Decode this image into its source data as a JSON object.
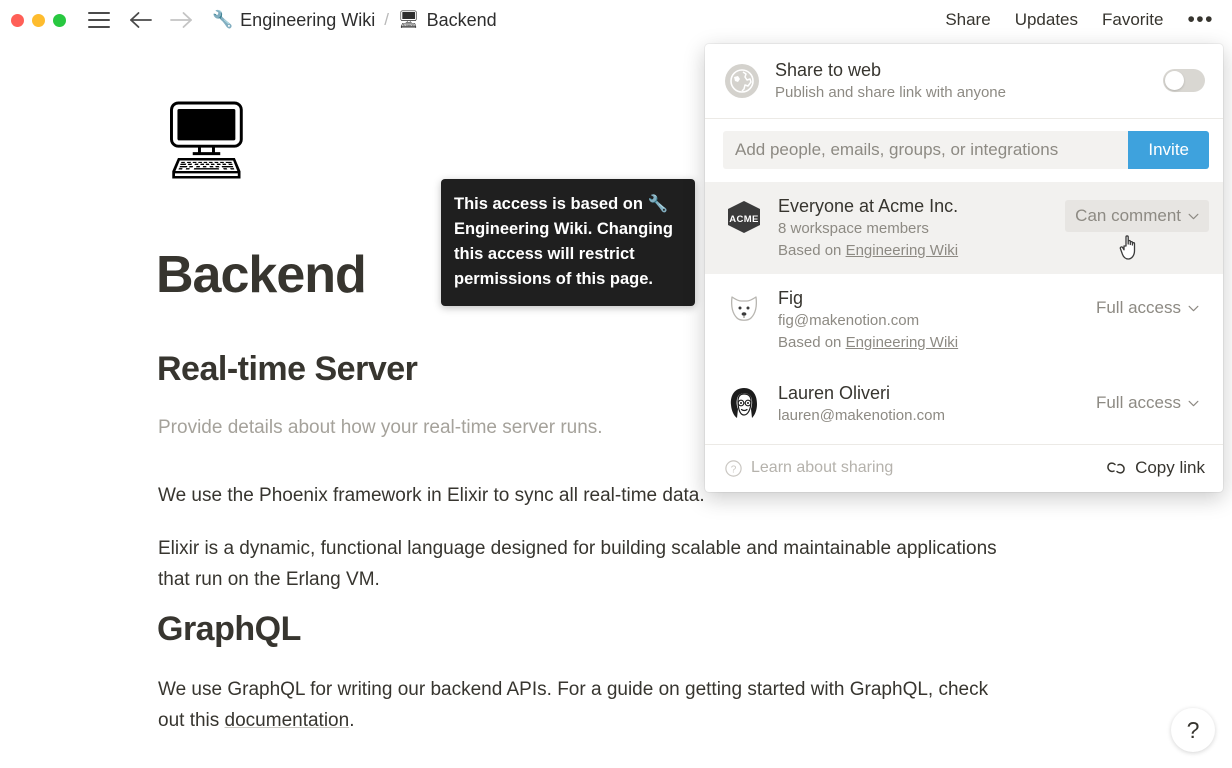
{
  "titlebar": {
    "window_controls": [
      "close",
      "minimize",
      "maximize"
    ],
    "menu_icon": "hamburger-icon",
    "back_label": "←",
    "forward_label": "→",
    "breadcrumb": [
      {
        "emoji": "🔧",
        "label": "Engineering Wiki"
      },
      {
        "emoji": "🖥",
        "label": "Backend"
      }
    ],
    "separator": "/",
    "actions": [
      {
        "label": "Share"
      },
      {
        "label": "Updates"
      },
      {
        "label": "Favorite"
      }
    ],
    "overflow": "•••"
  },
  "page": {
    "icon": "🖥",
    "title": "Backend",
    "blocks": [
      {
        "type": "h2",
        "text": "Real-time Server"
      },
      {
        "type": "placeholder",
        "text": "Provide details about how your real-time server runs."
      },
      {
        "type": "p",
        "text": "We use the Phoenix framework in Elixir to sync all real-time data."
      },
      {
        "type": "p",
        "text": "Elixir is a dynamic, functional language designed for building scalable and maintainable applications that run on the Erlang VM."
      },
      {
        "type": "h2",
        "text": "GraphQL"
      }
    ],
    "graphql_para_pre": "We use GraphQL for writing our backend APIs. For a guide on getting started with GraphQL, check out this ",
    "graphql_link": "documentation",
    "graphql_para_post": "."
  },
  "tooltip": {
    "line1": "This access is based on",
    "emoji": "🔧",
    "bold_source": "Engineering Wiki",
    "rest": ". Changing this access will restrict permissions of this page."
  },
  "share_popup": {
    "web": {
      "icon": "globe-icon",
      "title": "Share to web",
      "subtitle": "Publish and share link with anyone",
      "toggle_state": "off"
    },
    "invite": {
      "placeholder": "Add people, emails, groups, or integrations",
      "value": "",
      "button_label": "Invite",
      "button_color": "#3ea2dd"
    },
    "people": [
      {
        "avatar": "acme-logo",
        "avatar_text": "ACME",
        "name": "Everyone at Acme Inc.",
        "meta1": "8 workspace members",
        "meta2_prefix": "Based on ",
        "meta2_link": "Engineering Wiki",
        "access": "Can comment",
        "highlighted": true
      },
      {
        "avatar": "dog-avatar",
        "name": "Fig",
        "meta1": "fig@makenotion.com",
        "meta2_prefix": "Based on ",
        "meta2_link": "Engineering Wiki",
        "access": "Full access",
        "highlighted": false
      },
      {
        "avatar": "person-avatar",
        "name": "Lauren Oliveri",
        "meta1": "lauren@makenotion.com",
        "meta2_prefix": "",
        "meta2_link": "",
        "access": "Full access",
        "highlighted": false
      }
    ],
    "footer": {
      "learn_icon": "question-circle-icon",
      "learn_label": "Learn about sharing",
      "copy_icon": "link-icon",
      "copy_label": "Copy link"
    }
  },
  "help": {
    "label": "?"
  }
}
